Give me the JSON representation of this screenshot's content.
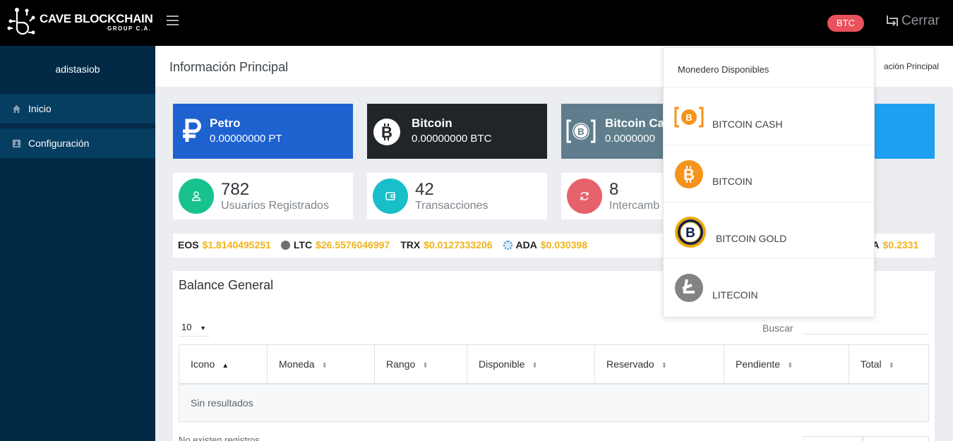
{
  "brand": {
    "title": "CAVE BLOCKCHAIN",
    "subtitle": "GROUP C.A."
  },
  "topbar": {
    "currency_badge": "BTC",
    "logout_label": "Cerrar"
  },
  "sidebar": {
    "username": "adistasiob",
    "items": [
      {
        "label": "Inicio",
        "icon": "home-icon"
      },
      {
        "label": "Configuración",
        "icon": "user-card-icon"
      }
    ]
  },
  "header": {
    "title": "Información Principal",
    "breadcrumb": "ación Principal"
  },
  "wallets": [
    {
      "name": "Petro",
      "balance": "0.00000000 PT",
      "color": "#1e62d0"
    },
    {
      "name": "Bitcoin",
      "balance": "0.00000000 BTC",
      "color": "#212429"
    },
    {
      "name": "Bitcoin Ca",
      "balance": "0.0000000",
      "color": "#5f7d8c"
    },
    {
      "color": "#1e9ff2"
    }
  ],
  "stats": [
    {
      "value": "782",
      "label": "Usuarios Registrados",
      "color": "#18c28f"
    },
    {
      "value": "42",
      "label": "Transacciones",
      "color": "#18bfc9"
    },
    {
      "value": "8",
      "label": "Intercamb",
      "color": "#e6626b"
    }
  ],
  "ticker": [
    {
      "symbol": "EOS",
      "price": "$1.8140495251"
    },
    {
      "symbol": "LTC",
      "price": "$26.5576046997"
    },
    {
      "symbol": "TRX",
      "price": "$0.0127333206"
    },
    {
      "symbol": "ADA",
      "price": "$0.030398"
    },
    {
      "symbol": "TA",
      "price": "$0.2331"
    }
  ],
  "balance": {
    "title": "Balance General",
    "page_length": "10",
    "search_label": "Buscar",
    "columns": [
      "Icono",
      "Moneda",
      "Rango",
      "Disponible",
      "Reservado",
      "Pendiente",
      "Total"
    ],
    "empty_row": "Sin resultados",
    "info": "No existen registros"
  },
  "wallet_dropdown": {
    "header": "Monedero Disponibles",
    "items": [
      {
        "label": "BITCOIN CASH",
        "icon": "bitcoin-cash-icon"
      },
      {
        "label": "BITCOIN",
        "icon": "bitcoin-icon"
      },
      {
        "label": "BITCOIN GOLD",
        "icon": "bitcoin-gold-icon"
      },
      {
        "label": "LITECOIN",
        "icon": "litecoin-icon"
      }
    ]
  }
}
